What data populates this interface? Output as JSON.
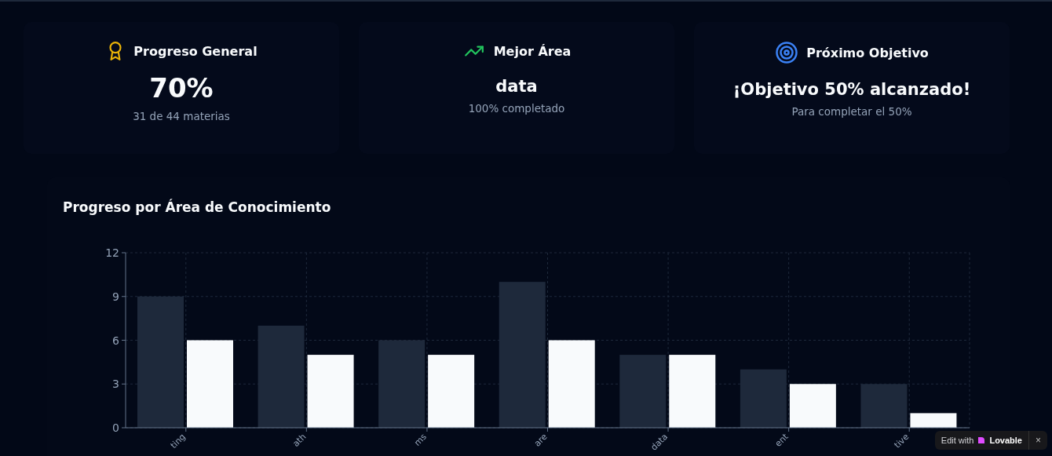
{
  "stats": [
    {
      "color": "#eab308",
      "title": "Progreso General",
      "value": "70%",
      "caption": "31 de 44 materias"
    },
    {
      "color": "#22c55e",
      "title": "Mejor Área",
      "value": "data",
      "caption": "100% completado"
    },
    {
      "color": "#3b82f6",
      "title": "Próximo Objetivo",
      "value": "¡Objetivo 50% alcanzado!",
      "caption": "Para completar el 50%"
    }
  ],
  "chart_panel": {
    "title": "Progreso por Área de Conocimiento",
    "chart_data": {
      "type": "bar",
      "categories": [
        "ting",
        "ath",
        "ms",
        "are",
        "data",
        "ent",
        "tive"
      ],
      "series": [
        {
          "color": "#1e293b",
          "values": [
            9,
            7,
            6,
            10,
            5,
            4,
            3
          ]
        },
        {
          "color": "#f8fafc",
          "values": [
            6,
            5,
            5,
            6,
            5,
            3,
            1
          ]
        }
      ],
      "grid": true,
      "ylim": [
        0,
        12
      ],
      "yticks": [
        0,
        3,
        6,
        9,
        12
      ]
    }
  },
  "badge": {
    "prefix": "Edit with",
    "brand": "Lovable",
    "close": "×"
  }
}
